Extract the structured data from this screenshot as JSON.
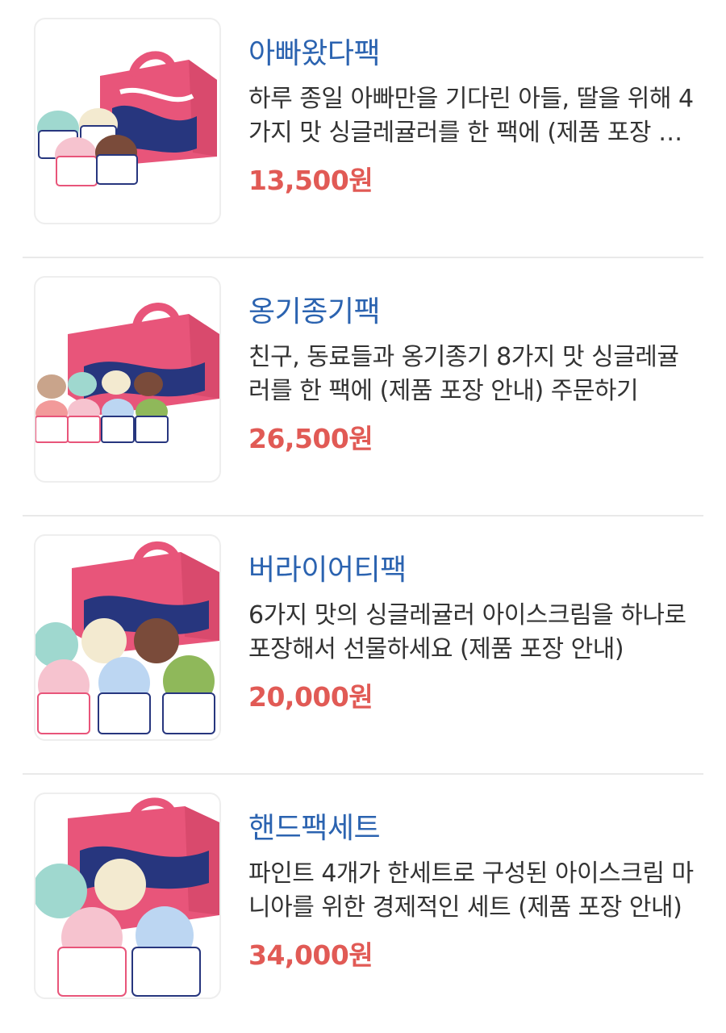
{
  "products": [
    {
      "name": "아빠왔다팩",
      "description": "하루 종일 아빠만을 기다린 아들, 딸을 위해 4가지 맛 싱글레귤러를 한 팩에 (제품 포장 안내)",
      "price": "13,500원",
      "image_icon": "ice-cream-pack-4-image"
    },
    {
      "name": "옹기종기팩",
      "description": "친구, 동료들과 옹기종기 8가지 맛 싱글레귤러를 한 팩에 (제품 포장 안내) 주문하기",
      "price": "26,500원",
      "image_icon": "ice-cream-pack-8-image"
    },
    {
      "name": "버라이어티팩",
      "description": "6가지 맛의 싱글레귤러 아이스크림을 하나로 포장해서 선물하세요 (제품 포장 안내)",
      "price": "20,000원",
      "image_icon": "ice-cream-pack-6-image"
    },
    {
      "name": "핸드팩세트",
      "description": "파인트 4개가 한세트로 구성된 아이스크림 마니아를 위한 경제적인 세트 (제품 포장 안내)",
      "price": "34,000원",
      "image_icon": "ice-cream-pint-set-image"
    }
  ],
  "colors": {
    "name": "#2b63b0",
    "price": "#e15a55",
    "box_pink": "#e8557a",
    "box_navy": "#27367e"
  }
}
